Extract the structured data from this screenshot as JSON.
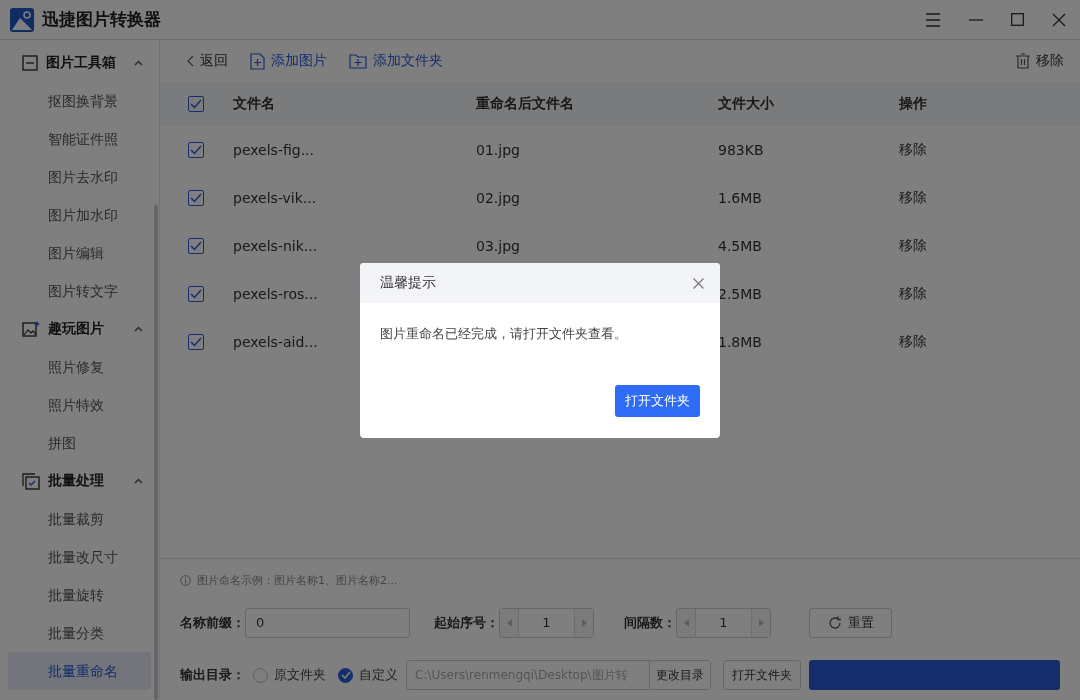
{
  "window": {
    "title": "迅捷图片转换器"
  },
  "sidebar": {
    "groups": [
      {
        "label": "图片工具箱",
        "expanded": true,
        "items": [
          {
            "label": "抠图换背景",
            "selected": false
          },
          {
            "label": "智能证件照",
            "selected": false
          },
          {
            "label": "图片去水印",
            "selected": false
          },
          {
            "label": "图片加水印",
            "selected": false
          },
          {
            "label": "图片编辑",
            "selected": false
          },
          {
            "label": "图片转文字",
            "selected": false
          }
        ]
      },
      {
        "label": "趣玩图片",
        "expanded": true,
        "items": [
          {
            "label": "照片修复",
            "selected": false
          },
          {
            "label": "照片特效",
            "selected": false
          },
          {
            "label": "拼图",
            "selected": false
          }
        ]
      },
      {
        "label": "批量处理",
        "expanded": true,
        "items": [
          {
            "label": "批量裁剪",
            "selected": false
          },
          {
            "label": "批量改尺寸",
            "selected": false
          },
          {
            "label": "批量旋转",
            "selected": false
          },
          {
            "label": "批量分类",
            "selected": false
          },
          {
            "label": "批量重命名",
            "selected": true
          }
        ]
      }
    ]
  },
  "toolbar": {
    "back": "返回",
    "add_image": "添加图片",
    "add_folder": "添加文件夹",
    "remove": "移除"
  },
  "table": {
    "all_checked": true,
    "columns": [
      "文件名",
      "重命名后文件名",
      "文件大小",
      "操作"
    ],
    "rows": [
      {
        "checked": true,
        "name": "pexels-fig...",
        "new_name": "01.jpg",
        "size": "983KB",
        "action": "移除"
      },
      {
        "checked": true,
        "name": "pexels-vik...",
        "new_name": "02.jpg",
        "size": "1.6MB",
        "action": "移除"
      },
      {
        "checked": true,
        "name": "pexels-nik...",
        "new_name": "03.jpg",
        "size": "4.5MB",
        "action": "移除"
      },
      {
        "checked": true,
        "name": "pexels-ros...",
        "size": "2.5MB",
        "action": "移除"
      },
      {
        "checked": true,
        "name": "pexels-aid...",
        "size": "1.8MB",
        "action": "移除"
      }
    ]
  },
  "settings": {
    "hint": "图片命名示例：图片名称1、图片名称2...",
    "prefix_label": "名称前缀：",
    "prefix_value": "0",
    "start_label": "起始序号：",
    "start_value": "1",
    "step_label": "间隔数：",
    "step_value": "1",
    "reset": "重置",
    "output_label": "输出目录：",
    "options": [
      {
        "label": "原文件夹",
        "selected": false
      },
      {
        "label": "自定义",
        "selected": true
      }
    ],
    "path": "C:\\Users\\renmengqi\\Desktop\\图片转",
    "change_dir": "更改目录",
    "open_folder": "打开文件夹"
  },
  "dialog": {
    "title": "温馨提示",
    "message": "图片重命名已经完成，请打开文件夹查看。",
    "button": "打开文件夹"
  }
}
